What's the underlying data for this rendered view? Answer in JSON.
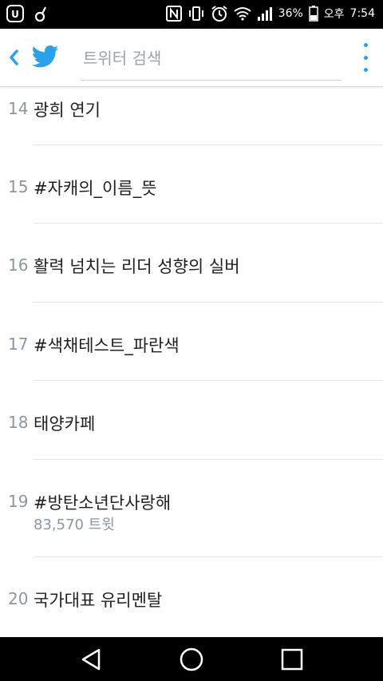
{
  "status_bar": {
    "battery_percent": "36%",
    "ampm": "오후",
    "time": "7:54",
    "left_icons": [
      "app-notification-icon",
      "music-note-icon"
    ],
    "right_icons": [
      "nfc-icon",
      "vibrate-icon",
      "alarm-icon",
      "wifi-icon",
      "signal-icon",
      "battery-icon"
    ]
  },
  "app_bar": {
    "search_placeholder": "트위터 검색",
    "accent_color": "#2aa1e8"
  },
  "trends": [
    {
      "rank": "14",
      "topic": "광희 연기"
    },
    {
      "rank": "15",
      "topic": "#자캐의_이름_뜻"
    },
    {
      "rank": "16",
      "topic": "활력 넘치는 리더 성향의 실버"
    },
    {
      "rank": "17",
      "topic": "#색채테스트_파란색"
    },
    {
      "rank": "18",
      "topic": "태양카페"
    },
    {
      "rank": "19",
      "topic": "#방탄소년단사랑해",
      "tweet_count": "83,570 트윗"
    },
    {
      "rank": "20",
      "topic": "국가대표 유리멘탈"
    }
  ],
  "nav_bar": {
    "icons": [
      "back-triangle-icon",
      "home-circle-icon",
      "recents-square-icon"
    ]
  }
}
